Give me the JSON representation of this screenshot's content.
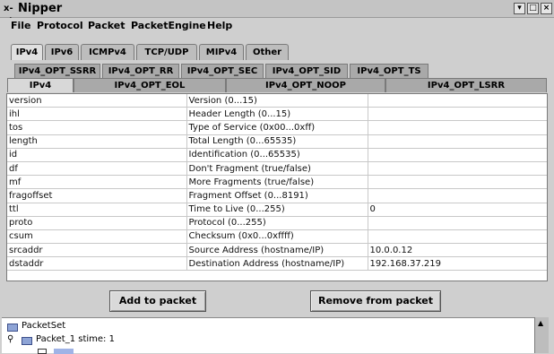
{
  "window": {
    "icon_text": "x-⊣",
    "title": "Nipper",
    "btn_min": "▾",
    "btn_max": "□",
    "btn_close": "×"
  },
  "menu": [
    "File",
    "Protocol",
    "Packet",
    "PacketEngine",
    "Help"
  ],
  "protocol_tabs": [
    {
      "label": "IPv4",
      "active": true
    },
    {
      "label": "IPv6"
    },
    {
      "label": "ICMPv4"
    },
    {
      "label": "TCP/UDP"
    },
    {
      "label": "MIPv4"
    },
    {
      "label": "Other"
    }
  ],
  "option_tabs_row1": [
    "IPv4_OPT_SSRR",
    "IPv4_OPT_RR",
    "IPv4_OPT_SEC",
    "IPv4_OPT_SID",
    "IPv4_OPT_TS"
  ],
  "option_tabs_row2": [
    {
      "label": "IPv4",
      "active": true
    },
    {
      "label": "IPv4_OPT_EOL"
    },
    {
      "label": "IPv4_OPT_NOOP"
    },
    {
      "label": "IPv4_OPT_LSRR"
    }
  ],
  "fields": [
    {
      "name": "version",
      "desc": "Version (0...15)",
      "value": ""
    },
    {
      "name": "ihl",
      "desc": "Header Length (0...15)",
      "value": ""
    },
    {
      "name": "tos",
      "desc": "Type of Service (0x00...0xff)",
      "value": ""
    },
    {
      "name": "length",
      "desc": "Total Length (0...65535)",
      "value": ""
    },
    {
      "name": "id",
      "desc": "Identification (0...65535)",
      "value": ""
    },
    {
      "name": "df",
      "desc": "Don't Fragment (true/false)",
      "value": ""
    },
    {
      "name": "mf",
      "desc": "More Fragments (true/false)",
      "value": ""
    },
    {
      "name": "fragoffset",
      "desc": "Fragment Offset (0...8191)",
      "value": ""
    },
    {
      "name": "ttl",
      "desc": "Time to Live (0...255)",
      "value": "0"
    },
    {
      "name": "proto",
      "desc": "Protocol (0...255)",
      "value": ""
    },
    {
      "name": "csum",
      "desc": "Checksum (0x0...0xffff)",
      "value": ""
    },
    {
      "name": "srcaddr",
      "desc": "Source Address (hostname/IP)",
      "value": "10.0.0.12"
    },
    {
      "name": "dstaddr",
      "desc": "Destination Address (hostname/IP)",
      "value": "192.168.37.219"
    }
  ],
  "buttons": {
    "add": "Add to packet",
    "remove": "Remove from packet"
  },
  "tree": {
    "root": "PacketSet",
    "child": "Packet_1 stime: 1"
  }
}
